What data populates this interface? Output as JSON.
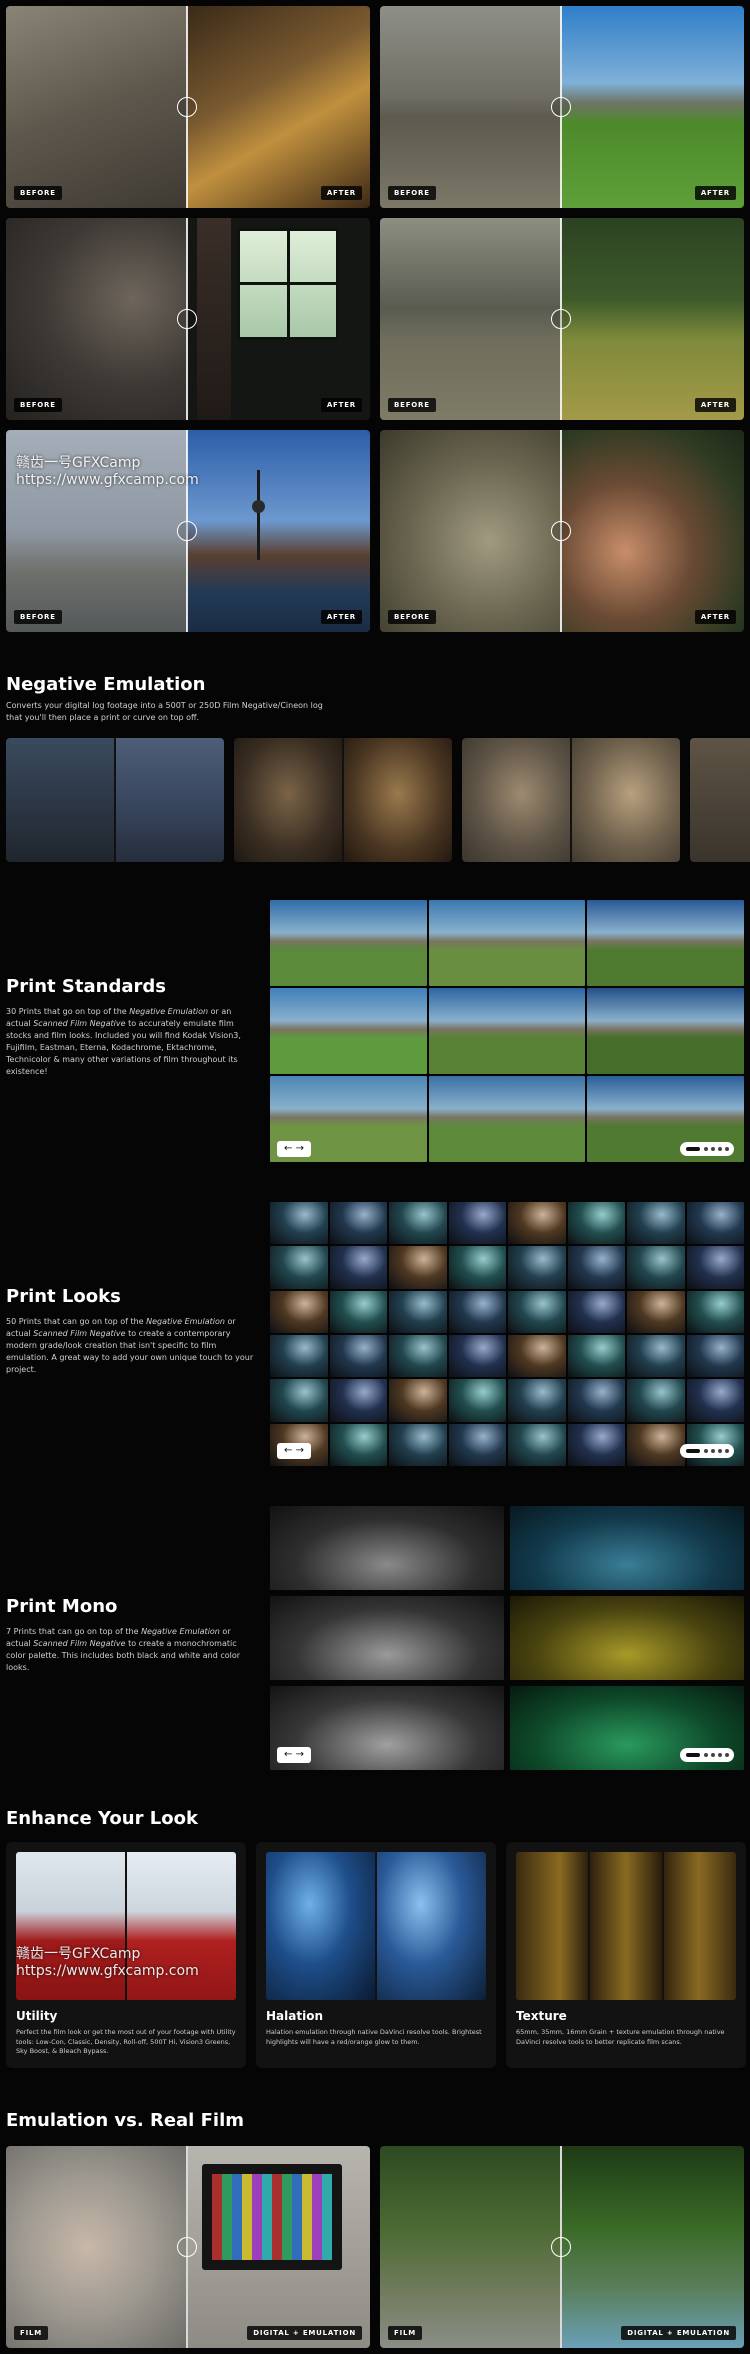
{
  "before_after": {
    "before_label": "BEFORE",
    "after_label": "AFTER",
    "panels": [
      {
        "name": "artist-studio",
        "before": "#6e675c",
        "after": "#5a3e22",
        "after_accent": "#b0803a"
      },
      {
        "name": "mountain-field",
        "before": "#7d7b6f",
        "after": "#4b8bbf",
        "after_accent": "#4f8a2e"
      },
      {
        "name": "window-dancer",
        "before": "#45403b",
        "after": "#1d211d",
        "after_accent": "#c8e0c0"
      },
      {
        "name": "forest-dance",
        "before": "#6e6f63",
        "after": "#3d5a2a",
        "after_accent": "#8fa34a"
      },
      {
        "name": "berlin-tower",
        "before": "#8a93a0",
        "after": "#3a6aa8",
        "after_accent": "#6b4a36"
      },
      {
        "name": "couple-lying",
        "before": "#6a6850",
        "after": "#3a4a2a",
        "after_accent": "#b88260"
      }
    ]
  },
  "watermark": {
    "line1": "赣齿一号GFXCamp",
    "line2": "https://www.gfxcamp.com"
  },
  "negative": {
    "title": "Negative Emulation",
    "desc": "Converts your digital log footage into a 500T or 250D Film Negative/Cineon log that you'll then place a print or curve on top off."
  },
  "print_standards": {
    "title": "Print Standards",
    "desc_a": "30 Prints that go on top of the ",
    "em1": "Negative Emulation",
    "desc_b": " or an actual ",
    "em2": "Scanned Film Negative",
    "desc_c": " to accurately emulate film stocks and film looks. Included you will find Kodak Vision3, Fujifilm, Eastman, Eterna, Kodachrome, Ektachrome, Technicolor & many other variations of film throughout its existence!"
  },
  "print_looks": {
    "title": "Print Looks",
    "desc_a": "50 Prints that can go on top of the ",
    "em1": "Negative Emulation",
    "desc_b": " or actual ",
    "em2": "Scanned Film Negative",
    "desc_c": " to create a contemporary modern grade/look creation that isn't specific to film emulation. A great way to add your own unique touch to your project."
  },
  "print_mono": {
    "title": "Print Mono",
    "desc_a": "7 Prints that can go on top of the ",
    "em1": "Negative Emulation",
    "desc_b": " or actual ",
    "em2": "Scanned Film Negative",
    "desc_c": " to create a monochromatic color palette. This includes both black and white and color looks."
  },
  "carousel": {
    "arrows": "← →"
  },
  "enhance": {
    "title": "Enhance Your Look",
    "cards": [
      {
        "title": "Utility",
        "desc": "Perfect the film look or get the most out of your footage with Utility tools: Low-Con, Classic, Density, Roll-off, 500T Hi, Vision3 Greens, Sky Boost, & Bleach Bypass."
      },
      {
        "title": "Halation",
        "desc": "Halation emulation through native DaVinci resolve tools. Brightest highlights will have a red/orange glow to them."
      },
      {
        "title": "Texture",
        "desc": "65mm, 35mm, 16mm Grain + texture emulation through native DaVinci resolve tools to better replicate film scans."
      }
    ]
  },
  "emulation": {
    "title": "Emulation vs. Real Film",
    "film_label": "FILM",
    "digital_label": "DIGITAL + EMULATION"
  }
}
